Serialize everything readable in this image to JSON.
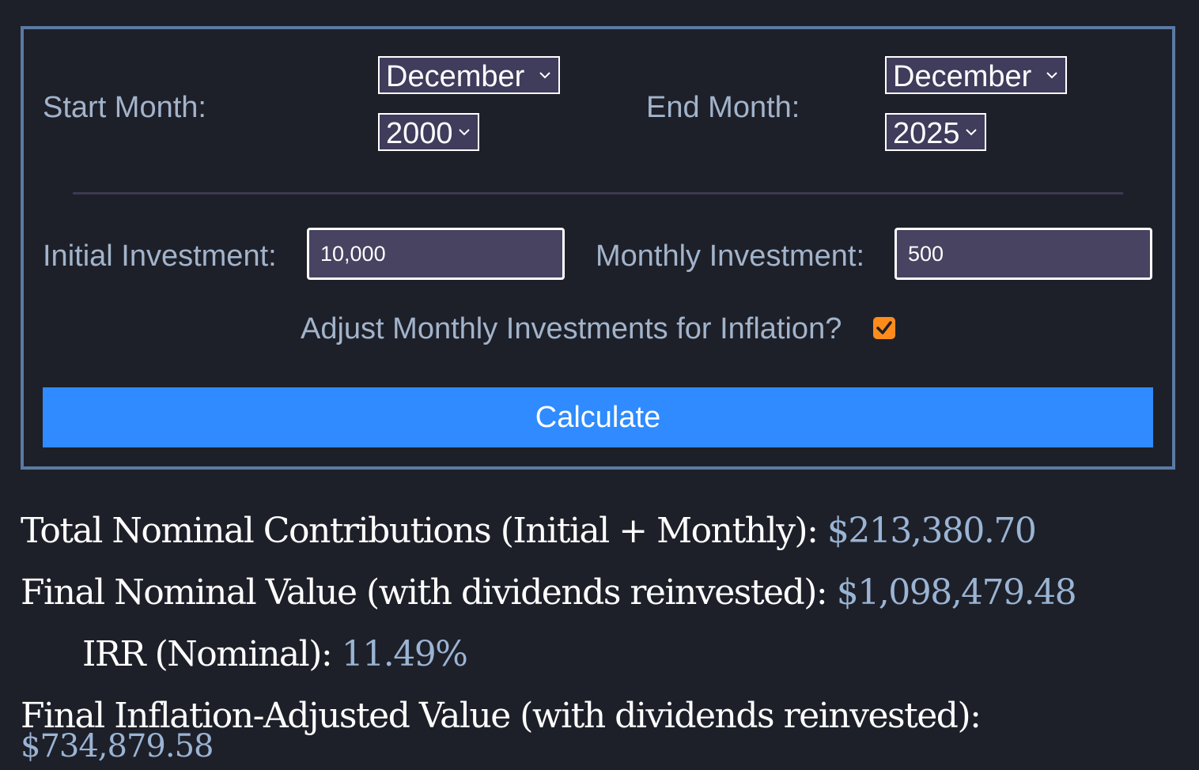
{
  "form": {
    "start_month_label": "Start Month:",
    "start_month_value": "December",
    "start_year_value": "2000",
    "end_month_label": "End Month:",
    "end_month_value": "December",
    "end_year_value": "2025",
    "initial_investment_label": "Initial Investment:",
    "initial_investment_value": "10,000",
    "monthly_investment_label": "Monthly Investment:",
    "monthly_investment_value": "500",
    "inflation_adjust_label": "Adjust Monthly Investments for Inflation?",
    "inflation_adjust_checked": true,
    "calculate_label": "Calculate"
  },
  "results": {
    "total_contrib_label": "Total Nominal Contributions (Initial + Monthly):",
    "total_contrib_value": "$213,380.70",
    "final_nominal_label": "Final Nominal Value (with dividends reinvested):",
    "final_nominal_value": "$1,098,479.48",
    "irr_label": "IRR (Nominal):",
    "irr_value": "11.49%",
    "final_real_label": "Final Inflation-Adjusted Value (with dividends reinvested):",
    "final_real_value": "$734,879.58"
  },
  "colors": {
    "background": "#1e2029",
    "panel_border": "#5a7aa3",
    "label_text": "#a2b4cb",
    "accent_button": "#2f8bff",
    "checkbox": "#ff8c1a",
    "result_value": "#9ab4d4"
  },
  "icons": {
    "select_arrow": "chevron-down-icon",
    "checkbox_mark": "checkmark-icon"
  }
}
